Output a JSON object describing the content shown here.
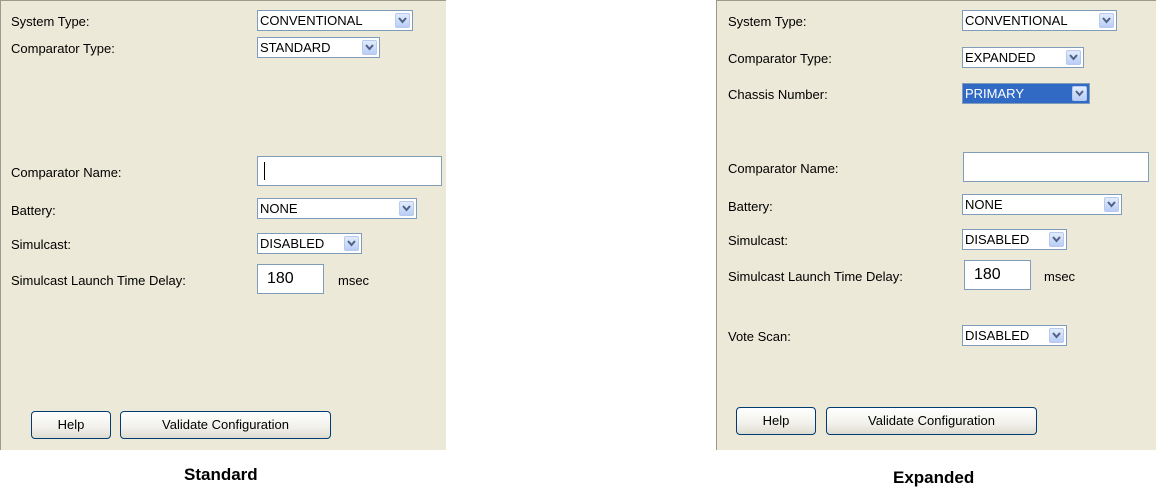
{
  "standard": {
    "caption": "Standard",
    "system_type": {
      "label": "System Type:",
      "value": "CONVENTIONAL"
    },
    "comparator_type": {
      "label": "Comparator Type:",
      "value": "STANDARD"
    },
    "comparator_name": {
      "label": "Comparator Name:",
      "value": ""
    },
    "battery": {
      "label": "Battery:",
      "value": "NONE"
    },
    "simulcast": {
      "label": "Simulcast:",
      "value": "DISABLED"
    },
    "delay": {
      "label": "Simulcast Launch Time Delay:",
      "value": "180",
      "unit": "msec"
    },
    "help_label": "Help",
    "validate_label": "Validate Configuration"
  },
  "expanded": {
    "caption": "Expanded",
    "system_type": {
      "label": "System Type:",
      "value": "CONVENTIONAL"
    },
    "comparator_type": {
      "label": "Comparator Type:",
      "value": "EXPANDED"
    },
    "chassis_number": {
      "label": "Chassis Number:",
      "value": "PRIMARY"
    },
    "comparator_name": {
      "label": "Comparator Name:",
      "value": ""
    },
    "battery": {
      "label": "Battery:",
      "value": "NONE"
    },
    "simulcast": {
      "label": "Simulcast:",
      "value": "DISABLED"
    },
    "delay": {
      "label": "Simulcast Launch Time Delay:",
      "value": "180",
      "unit": "msec"
    },
    "vote_scan": {
      "label": "Vote Scan:",
      "value": "DISABLED"
    },
    "help_label": "Help",
    "validate_label": "Validate Configuration"
  },
  "icons": {
    "dropdown": "chevron-down-icon"
  },
  "colors": {
    "panel_bg": "#ece9d8",
    "highlight": "#316ac5",
    "field_border": "#7f9db9"
  }
}
